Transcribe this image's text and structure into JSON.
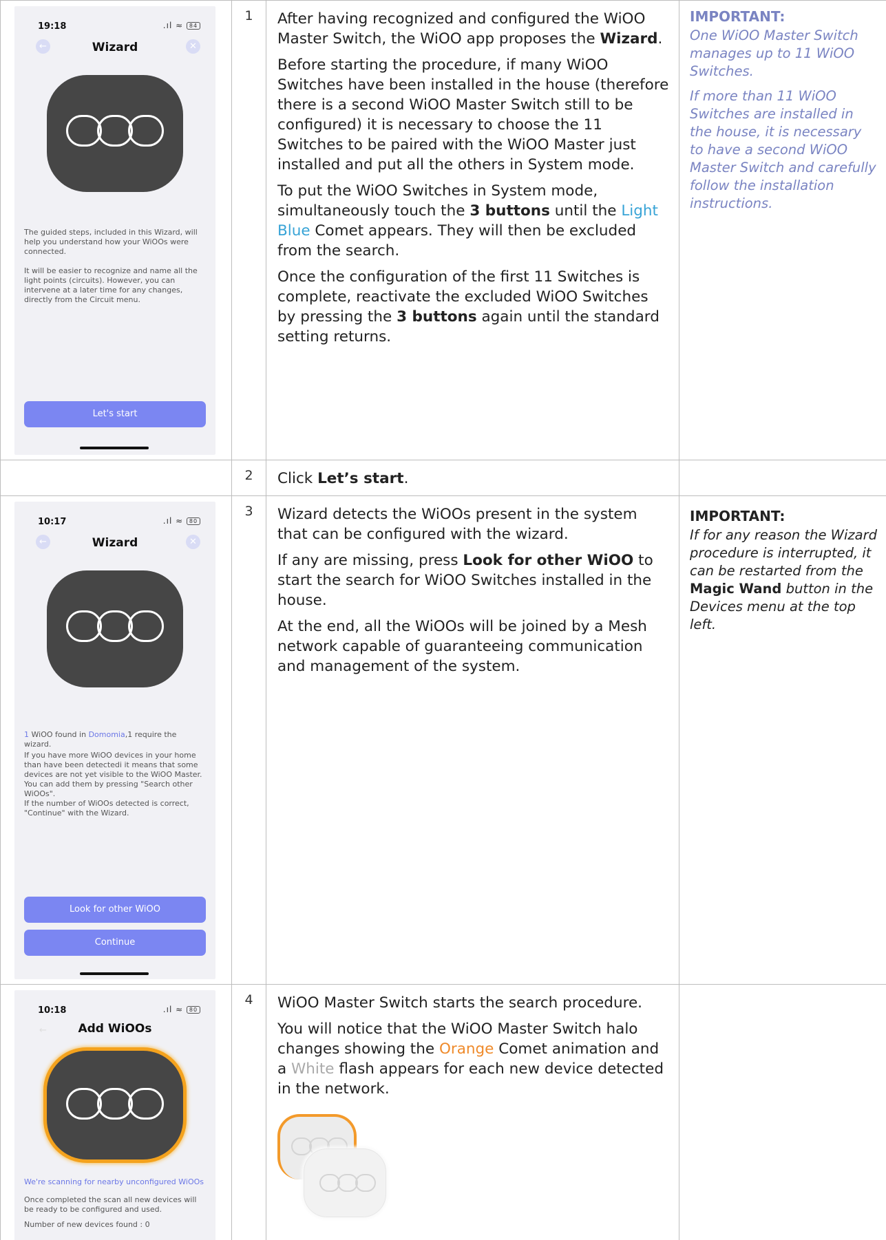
{
  "rows": [
    {
      "step": "1",
      "phone": {
        "time": "19:18",
        "battery": "84",
        "title": "Wizard",
        "text1": "The guided steps, included in this Wizard, will help you understand how your WiOOs were connected.",
        "text2": "It will be easier to recognize and name all the light points (circuits). However, you can intervene at a later time for any changes, directly from the Circuit menu.",
        "button": "Let's start"
      },
      "p1_a": "After having recognized and configured the WiOO Master Switch, the WiOO app proposes the ",
      "p1_b": "Wizard",
      "p1_c": ".",
      "p2": "Before starting the procedure, if many WiOO Switches have been installed in the house (therefore there is a second WiOO Master Switch still to be configured) it is necessary to choose the 11 Switches to be paired with the WiOO Master just installed and put all the others in System mode.",
      "p3_a": "To put the WiOO Switches in System mode, simultaneously touch the ",
      "p3_b": "3 buttons",
      "p3_c": " until the ",
      "p3_d": "Light Blue",
      "p3_e": " Comet appears. They will then be excluded from the search.",
      "p4_a": "Once the configuration of the first 11 Switches is complete, reactivate the excluded WiOO Switches by pressing the ",
      "p4_b": "3 buttons",
      "p4_c": " again until the standard setting returns.",
      "note_title": "IMPORTANT:",
      "note_1": "One WiOO Master Switch manages up to 11 WiOO Switches.",
      "note_2": "If more than 11 WiOO Switches are installed in the house, it is necessary to have a second WiOO Master Switch and carefully follow the installation instructions."
    },
    {
      "step": "2",
      "p1_a": "Click ",
      "p1_b": "Let’s start",
      "p1_c": "."
    },
    {
      "step": "3",
      "phone": {
        "time": "10:17",
        "battery": "80",
        "title": "Wizard",
        "found_a": "1",
        "found_b": " WiOO found in ",
        "found_c": "Domomia",
        "found_d": ",1 require the wizard.",
        "text1": "If you have more WiOO devices in your home than have been detectedi it means that some devices are not yet visible to the WiOO Master. You can add them by pressing \"Search other WiOOs\".",
        "text2": "If the number of WiOOs detected is correct, \"Continue\" with the Wizard.",
        "button1": "Look for other WiOO",
        "button2": "Continue"
      },
      "p1": "Wizard detects the WiOOs present in the system that can be configured with the wizard.",
      "p2_a": "If any are missing, press ",
      "p2_b": "Look for other WiOO",
      "p2_c": " to start the search for WiOO Switches installed in the house.",
      "p3": "At the end, all the WiOOs will be joined by a Mesh network capable of guaranteeing communication and management of the system.",
      "note_title": "IMPORTANT:",
      "note_a": "If for any reason the Wizard procedure is interrupted, it can be restarted from the ",
      "note_b": "Magic Wand",
      "note_c": " button in the Devices menu at the top left."
    },
    {
      "step": "4",
      "phone": {
        "time": "10:18",
        "battery": "80",
        "title": "Add WiOOs",
        "scanning": "We're scanning for nearby unconfigured WiOOs",
        "text1": "Once completed the scan all new devices will be ready to be configured and used.",
        "text2": "Number of new devices found : 0"
      },
      "p1": "WiOO Master Switch starts the search procedure.",
      "p2_a": "You will notice that the WiOO Master Switch halo changes showing the ",
      "p2_b": "Orange",
      "p2_c": " Comet animation and a ",
      "p2_d": "White",
      "p2_e": " flash appears for each new device detected in the network."
    }
  ],
  "colors": {
    "light_blue": "#37a3d6",
    "orange": "#ef8a2a",
    "note_purple": "#7a84c2",
    "app_button": "#7b86f2"
  }
}
